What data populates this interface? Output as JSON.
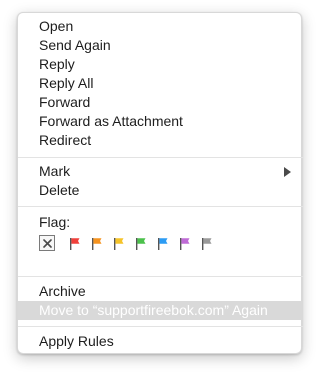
{
  "menu": {
    "group1": [
      "Open",
      "Send Again",
      "Reply",
      "Reply All",
      "Forward",
      "Forward as Attachment",
      "Redirect"
    ],
    "mark_label": "Mark",
    "delete_label": "Delete",
    "flag_label": "Flag:",
    "flags": [
      {
        "name": "none",
        "icon": "clear-flag-icon"
      },
      {
        "name": "red",
        "color": "#f0403b",
        "icon": "flag-icon"
      },
      {
        "name": "orange",
        "color": "#f5931f",
        "icon": "flag-icon"
      },
      {
        "name": "yellow",
        "color": "#f5c328",
        "icon": "flag-icon"
      },
      {
        "name": "green",
        "color": "#4bc14b",
        "icon": "flag-icon"
      },
      {
        "name": "blue",
        "color": "#2c9cf4",
        "icon": "flag-icon"
      },
      {
        "name": "purple",
        "color": "#bf6bd6",
        "icon": "flag-icon"
      },
      {
        "name": "gray",
        "color": "#9a9a9a",
        "icon": "flag-icon"
      }
    ],
    "archive_label": "Archive",
    "move_again_label": "Move to “supportfireebok.com” Again",
    "apply_rules_label": "Apply Rules"
  }
}
